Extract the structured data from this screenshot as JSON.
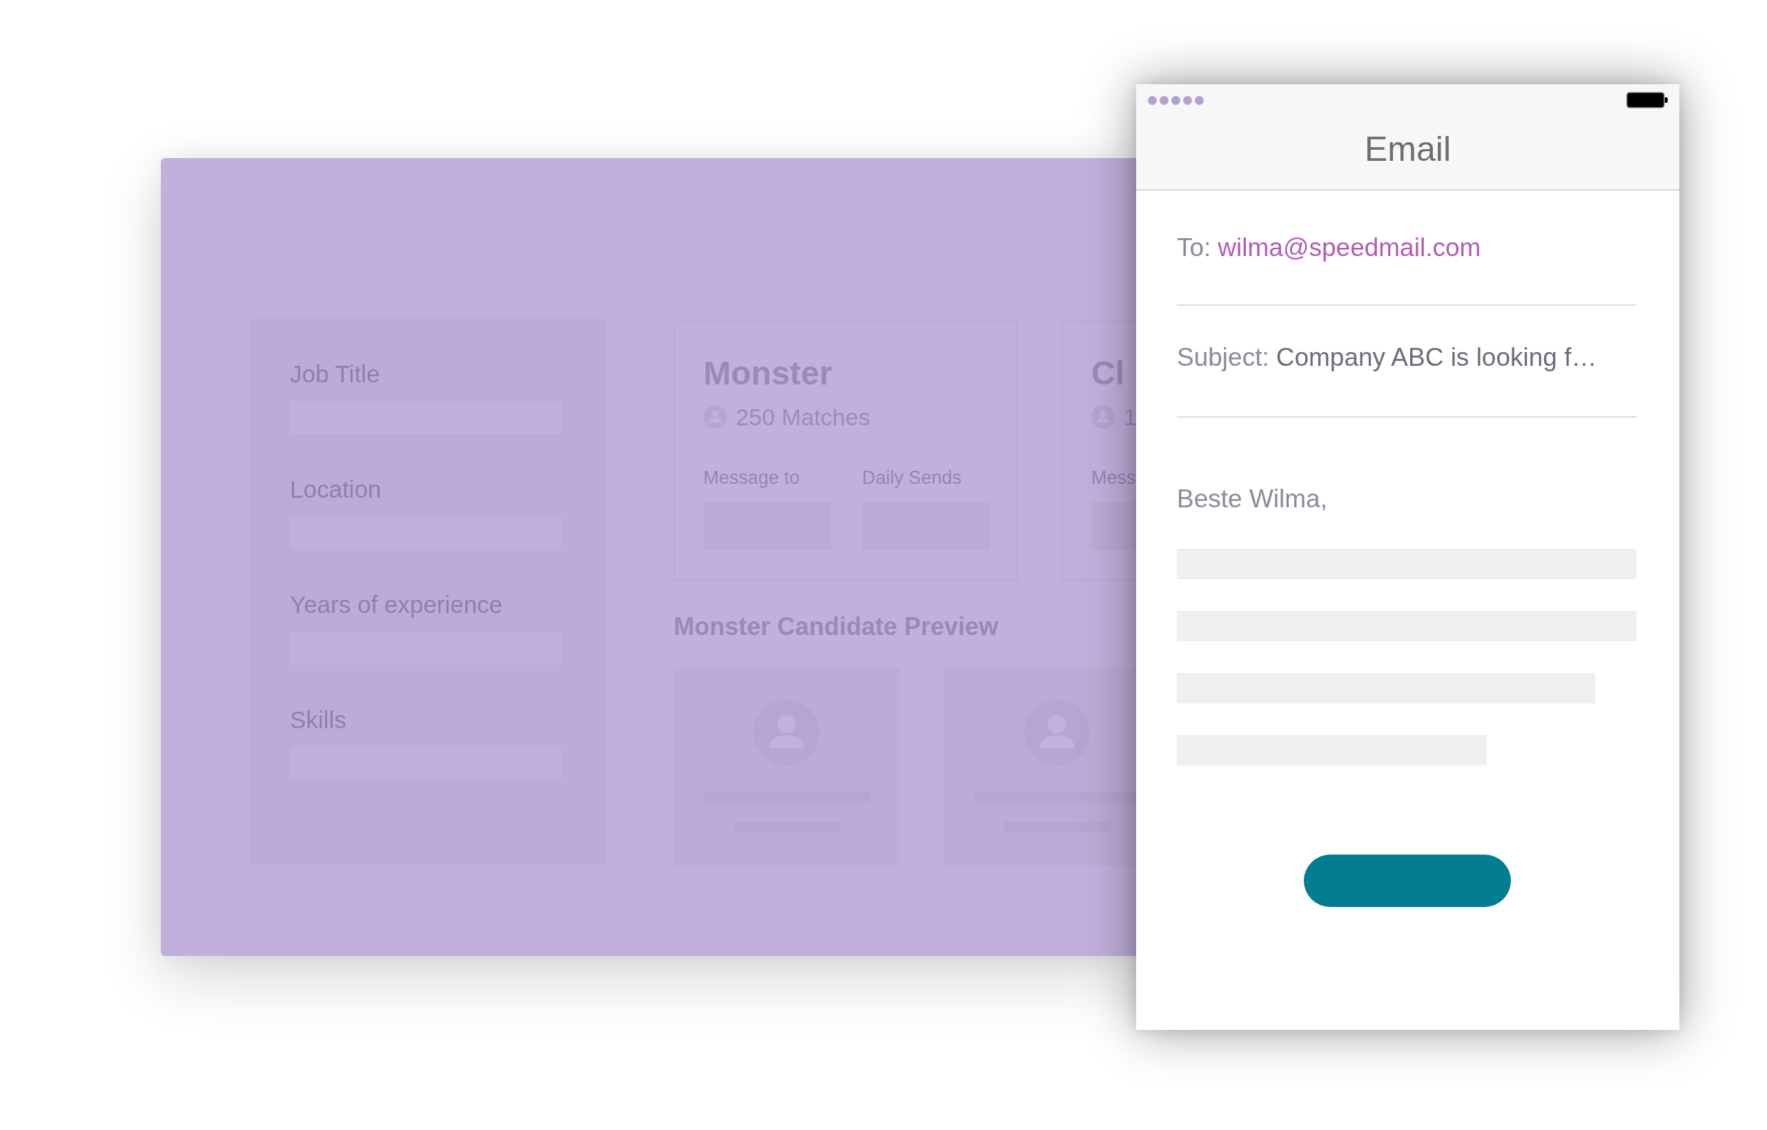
{
  "dashboard": {
    "search_form": {
      "fields": [
        {
          "label": "Job Title"
        },
        {
          "label": "Location"
        },
        {
          "label": "Years of experience"
        },
        {
          "label": "Skills"
        }
      ]
    },
    "job_boards": [
      {
        "name": "Monster",
        "matches": "250 Matches",
        "settings": [
          {
            "label": "Message to"
          },
          {
            "label": "Daily Sends"
          }
        ]
      },
      {
        "name": "Cl",
        "matches": "1",
        "settings": [
          {
            "label": "Mess"
          }
        ]
      }
    ],
    "candidate_preview": {
      "title": "Monster Candidate Preview"
    }
  },
  "email_phone": {
    "title": "Email",
    "to": {
      "label": "To:",
      "value": "wilma@speedmail.com"
    },
    "subject": {
      "label": "Subject:",
      "value": "Company ABC is looking f…"
    },
    "greeting": "Beste Wilma,"
  }
}
